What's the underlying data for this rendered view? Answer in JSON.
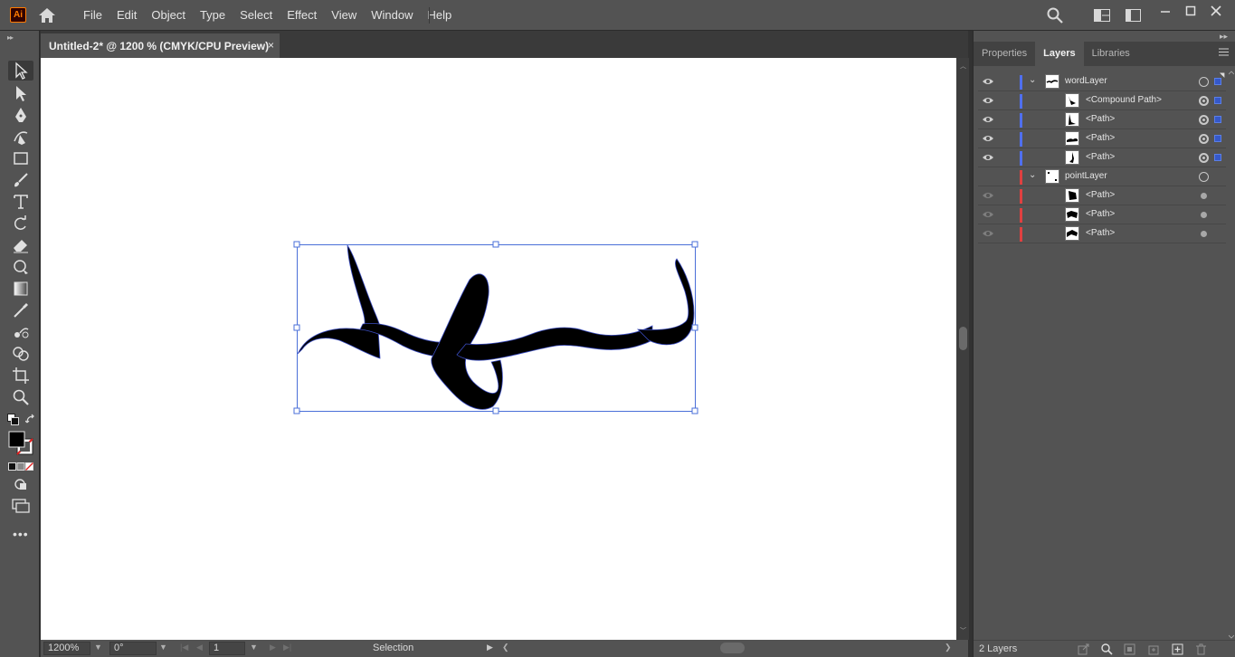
{
  "app": {
    "logo_text": "Ai",
    "menu": [
      "File",
      "Edit",
      "Object",
      "Type",
      "Select",
      "Effect",
      "View",
      "Window",
      "Help"
    ]
  },
  "document": {
    "tab_title": "Untitled-2* @ 1200 % (CMYK/CPU Preview)",
    "close_glyph": "×"
  },
  "status": {
    "zoom": "1200%",
    "rotation": "0°",
    "artboard": "1",
    "tool": "Selection"
  },
  "panel": {
    "tabs": [
      "Properties",
      "Layers",
      "Libraries"
    ],
    "active_tab": "Layers",
    "layers": [
      {
        "name": "wordLayer",
        "type": "layer",
        "visible": true,
        "color": "#4f6ff0",
        "expanded": true
      },
      {
        "name": "<Compound Path>",
        "type": "item",
        "visible": true,
        "color": "#4f6ff0"
      },
      {
        "name": "<Path>",
        "type": "item",
        "visible": true,
        "color": "#4f6ff0"
      },
      {
        "name": "<Path>",
        "type": "item",
        "visible": true,
        "color": "#4f6ff0"
      },
      {
        "name": "<Path>",
        "type": "item",
        "visible": true,
        "color": "#4f6ff0"
      },
      {
        "name": "pointLayer",
        "type": "layer",
        "visible": false,
        "color": "#e04040",
        "expanded": true
      },
      {
        "name": "<Path>",
        "type": "item",
        "visible": false,
        "color": "#e04040"
      },
      {
        "name": "<Path>",
        "type": "item",
        "visible": false,
        "color": "#e04040"
      },
      {
        "name": "<Path>",
        "type": "item",
        "visible": false,
        "color": "#e04040"
      }
    ],
    "layer_count": "2 Layers"
  },
  "colors": {
    "selection": "#4a6fd8",
    "fill": "#000000",
    "ui_dark": "#535353"
  }
}
